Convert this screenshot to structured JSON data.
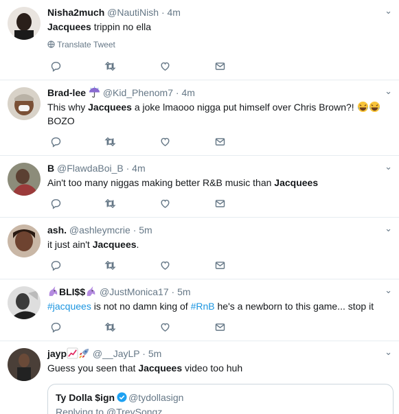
{
  "tweets": [
    {
      "name": "Nisha2much",
      "handle": "@NautiNish",
      "time": "4m",
      "text_parts": [
        "Jacquees",
        " trippin no ella"
      ],
      "translate": "Translate Tweet",
      "avatar_color": "#2a1f1a"
    },
    {
      "name": "Brad-lee",
      "handle": "@Kid_Phenom7",
      "time": "4m",
      "text_parts": [
        "This why ",
        "Jacquees",
        " a joke lmaooo nigga put himself over Chris Brown?!",
        "BOZO"
      ],
      "avatar_color": "#6b4a34"
    },
    {
      "name": "B",
      "handle": "@FlawdaBoi_B",
      "time": "4m",
      "text_parts": [
        "Ain't too many niggas making better R&B music than ",
        "Jacquees"
      ],
      "avatar_color": "#4a3a2e"
    },
    {
      "name": "ash.",
      "handle": "@ashleymcrie",
      "time": "5m",
      "text_parts": [
        "it just ain't ",
        "Jacquees",
        "."
      ],
      "avatar_color": "#3b2418"
    },
    {
      "name": "BLI$$",
      "handle": "@JustMonica17",
      "time": "5m",
      "text_parts": [
        "#jacquees",
        " is not no damn king of ",
        "#RnB",
        " he's a newborn to this game... stop it"
      ],
      "avatar_color": "#2c2c2c"
    },
    {
      "name": "jayp",
      "handle": "@__JayLP",
      "time": "5m",
      "text_parts": [
        "Guess you seen that ",
        "Jacquees",
        " video too huh"
      ],
      "avatar_color": "#3a2a22"
    }
  ],
  "quote": {
    "name": "Ty Dolla $ign",
    "handle": "@tydollasign",
    "reply": "Replying to @TreySongz"
  },
  "dot": "·",
  "caret": "⌄",
  "colors": {
    "link": "#1b95e0",
    "muted": "#657786",
    "border": "#e6ecf0"
  }
}
